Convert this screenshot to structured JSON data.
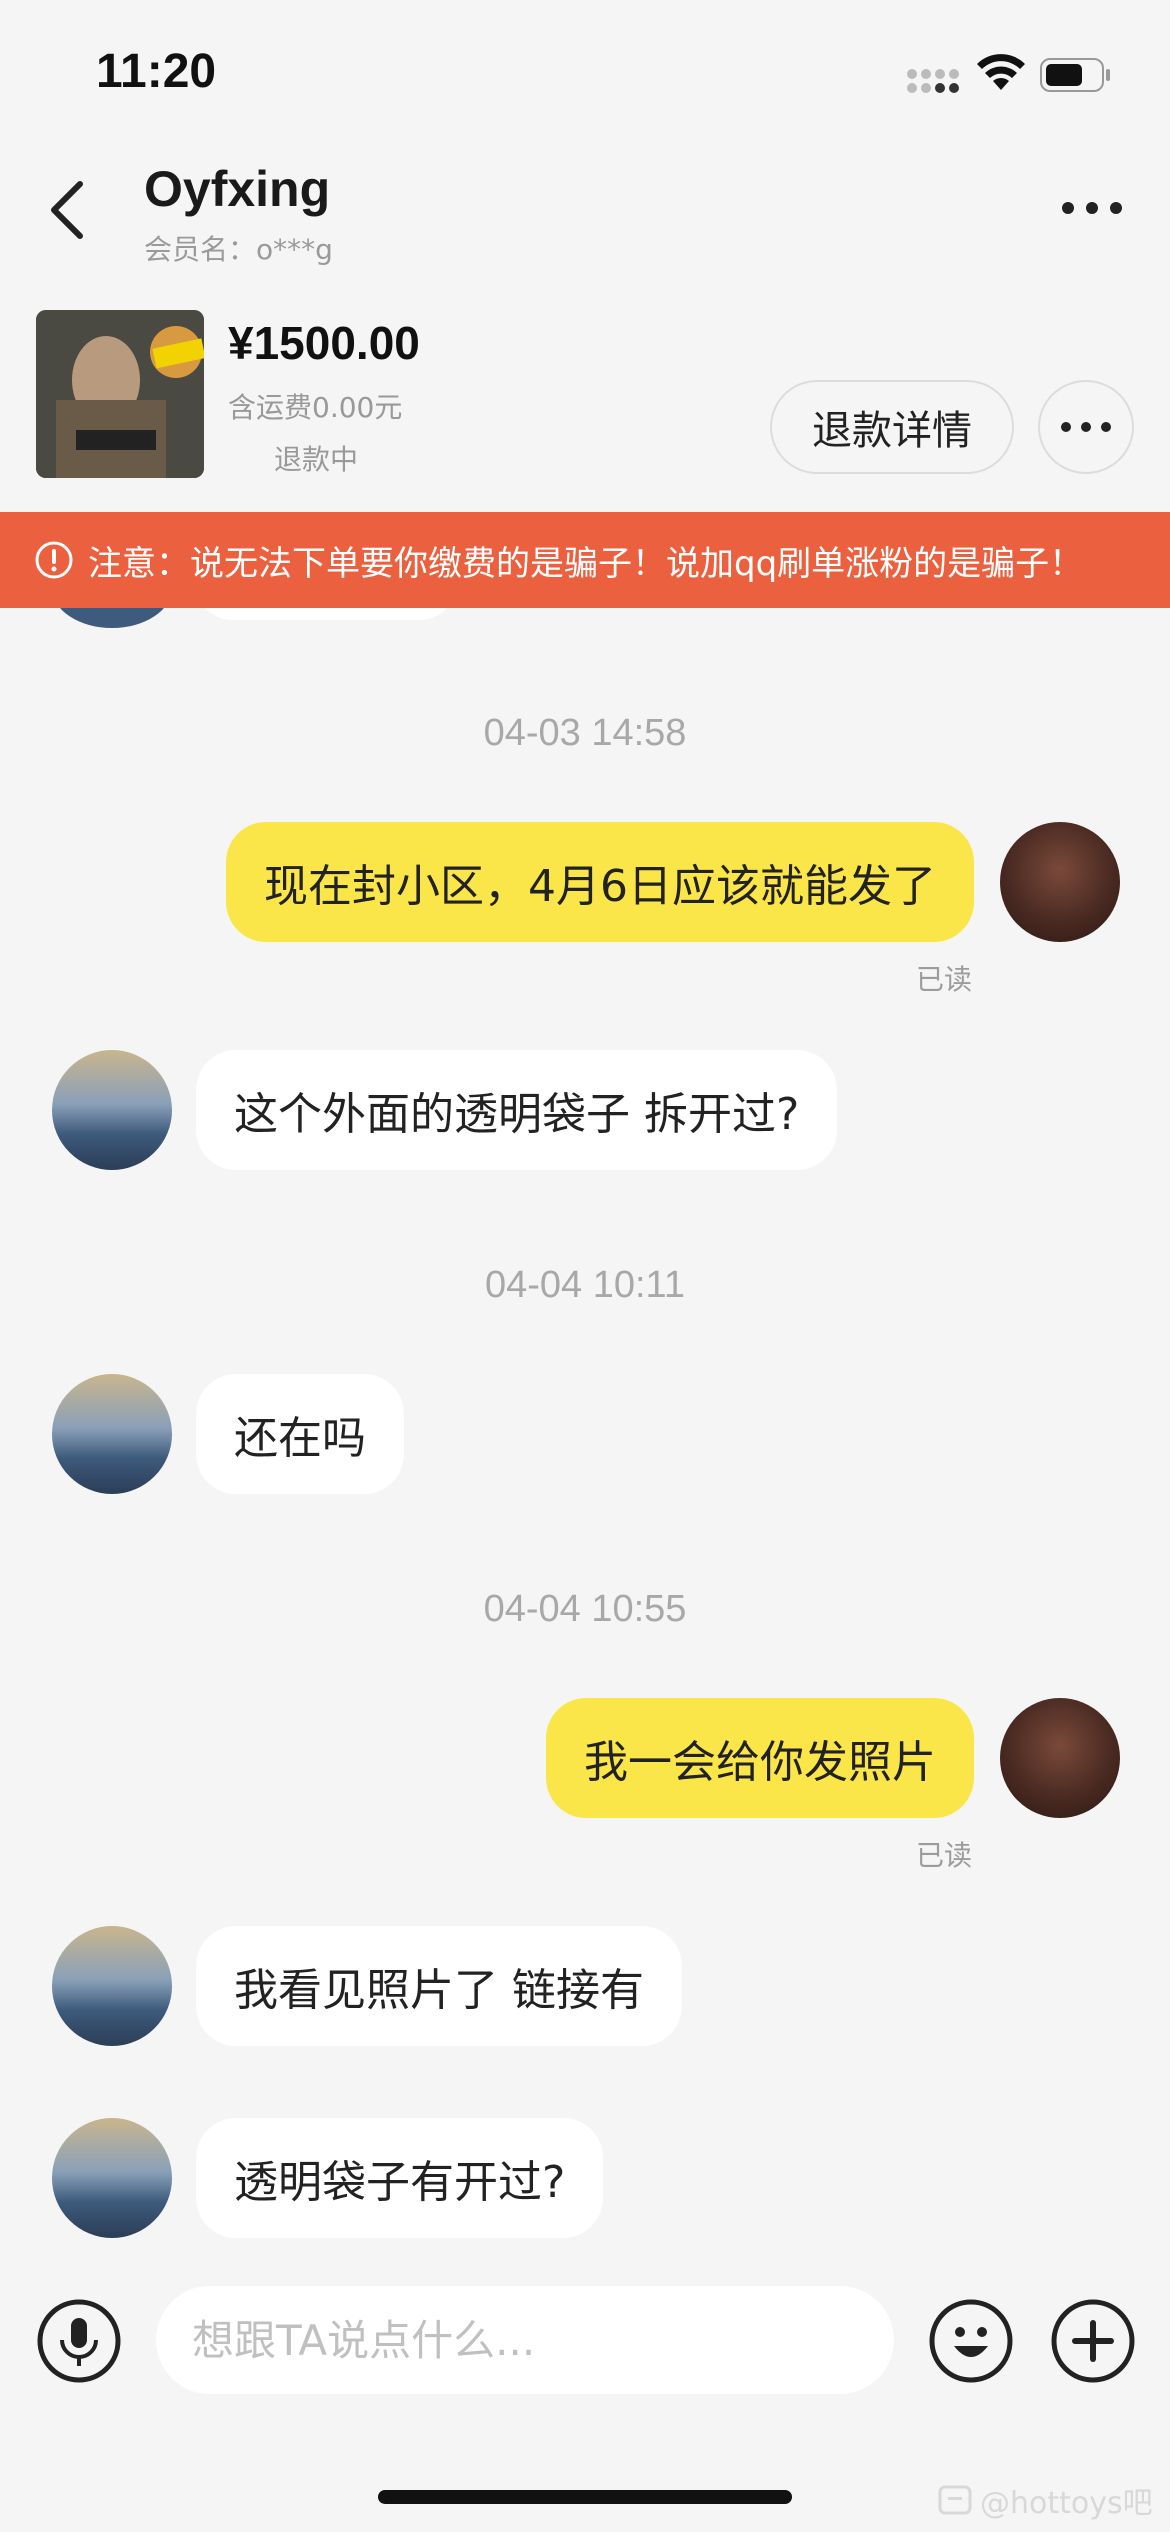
{
  "status_bar": {
    "time": "11:20"
  },
  "header": {
    "contact_name": "Oyfxing",
    "member_name": "会员名：o***g"
  },
  "product": {
    "price": "¥1500.00",
    "shipping": "含运费0.00元",
    "status": "退款中",
    "refund_button_label": "退款详情"
  },
  "warning": {
    "text": "注意：说无法下单要你缴费的是骗子！说加qq刷单涨粉的是骗子！"
  },
  "messages": [
    {
      "type": "timestamp",
      "text": "04-03 14:58"
    },
    {
      "type": "self",
      "text": "现在封小区，4月6日应该就能发了",
      "read": "已读"
    },
    {
      "type": "other",
      "text": "这个外面的透明袋子 拆开过?"
    },
    {
      "type": "timestamp",
      "text": "04-04 10:11"
    },
    {
      "type": "other",
      "text": "还在吗"
    },
    {
      "type": "timestamp",
      "text": "04-04 10:55"
    },
    {
      "type": "self",
      "text": "我一会给你发照片",
      "read": "已读"
    },
    {
      "type": "other",
      "text": "我看见照片了 链接有"
    },
    {
      "type": "other",
      "text": "透明袋子有开过?"
    }
  ],
  "input": {
    "placeholder": "想跟TA说点什么..."
  },
  "watermark": "@hottoys吧",
  "colors": {
    "self_bubble": "#fbe64a",
    "warning": "#eb6140",
    "background": "#f5f5f5"
  }
}
